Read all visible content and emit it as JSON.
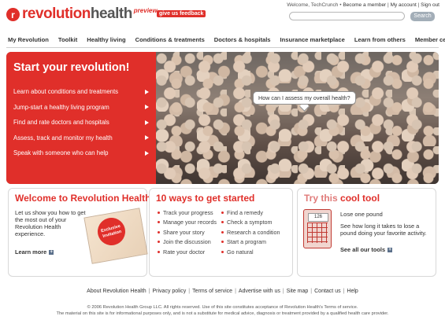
{
  "header": {
    "logo_mark": "r",
    "logo_name_first": "revolution",
    "logo_name_second": "health",
    "logo_tag": "preview",
    "feedback_label": "give us feedback",
    "welcome_text": "Welcome, TechCrunch •",
    "become_member": "Become a member",
    "my_account": "My account",
    "sign_out": "Sign out",
    "separator": "|",
    "search_placeholder": "",
    "search_button": "Search"
  },
  "nav": {
    "items": [
      "My Revolution",
      "Toolkit",
      "Healthy living",
      "Conditions & treatments",
      "Doctors & hospitals",
      "Insurance marketplace",
      "Learn from others",
      "Member central"
    ]
  },
  "hero": {
    "title": "Start your revolution!",
    "items": [
      "Learn about conditions and treatments",
      "Jump-start a healthy living program",
      "Find and rate doctors and hospitals",
      "Assess, track and monitor my health",
      "Speak with someone who can help"
    ],
    "bubble": "How can I assess my overall health?"
  },
  "welcome_box": {
    "title": "Welcome to Revolution Health",
    "text": "Let us show you how to get the most out of your Revolution Health experience.",
    "learn_more": "Learn more",
    "badge": "Exclusive Invitation"
  },
  "ways_box": {
    "title": "10 ways to get started",
    "col1": [
      "Track your progress",
      "Manage your records",
      "Share your story",
      "Join the discussion",
      "Rate your doctor"
    ],
    "col2": [
      "Find a remedy",
      "Check a symptom",
      "Research a condition",
      "Start a program",
      "Go natural"
    ]
  },
  "tool_box": {
    "title_a": "Try this",
    "title_b": "cool tool",
    "scale_number": "126",
    "tool_name": "Lose one pound",
    "tool_text": "See how long it takes to lose a pound doing your favorite activity.",
    "see_all": "See all our tools"
  },
  "footer": {
    "links": [
      "About Revolution Health",
      "Privacy policy",
      "Terms of service",
      "Advertise with us",
      "Site map",
      "Contact us",
      "Help"
    ],
    "copyright": "© 2006 Revolution Health Group LLC. All rights reserved. Use of this site constitutes acceptance of Revolution Health's Terms of service.",
    "disclaimer": "The material on this site is for informational purposes only, and is not a substitute for medical advice, diagnosis or treatment provided by a qualified health care provider."
  },
  "colors": {
    "brand_red": "#e02f2a",
    "search_button": "#a3aeb8"
  }
}
